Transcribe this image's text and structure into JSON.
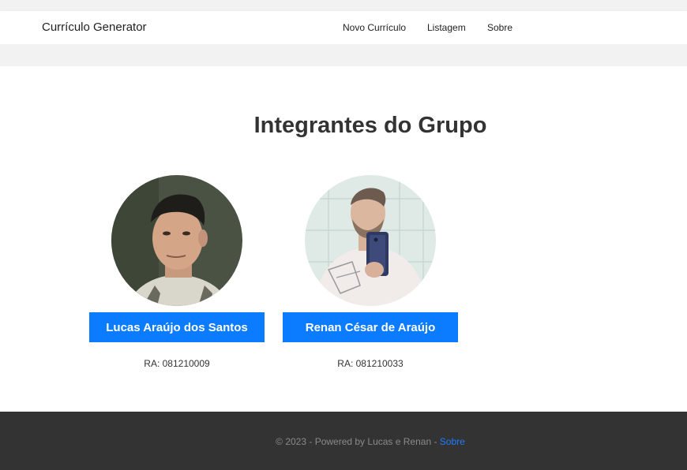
{
  "navbar": {
    "brand": "Currículo Generator",
    "links": [
      "Novo Currículo",
      "Listagem",
      "Sobre"
    ]
  },
  "main": {
    "title": "Integrantes do Grupo",
    "members": [
      {
        "name": "Lucas Araújo dos Santos",
        "ra": "RA: 081210009"
      },
      {
        "name": "Renan César de Araújo",
        "ra": "RA: 081210033"
      }
    ]
  },
  "footer": {
    "text": "© 2023 - Powered by Lucas e Renan - ",
    "link": "Sobre"
  },
  "colors": {
    "accent": "#0b7bff",
    "footer_bg": "#333333",
    "link": "#1e7dff"
  }
}
